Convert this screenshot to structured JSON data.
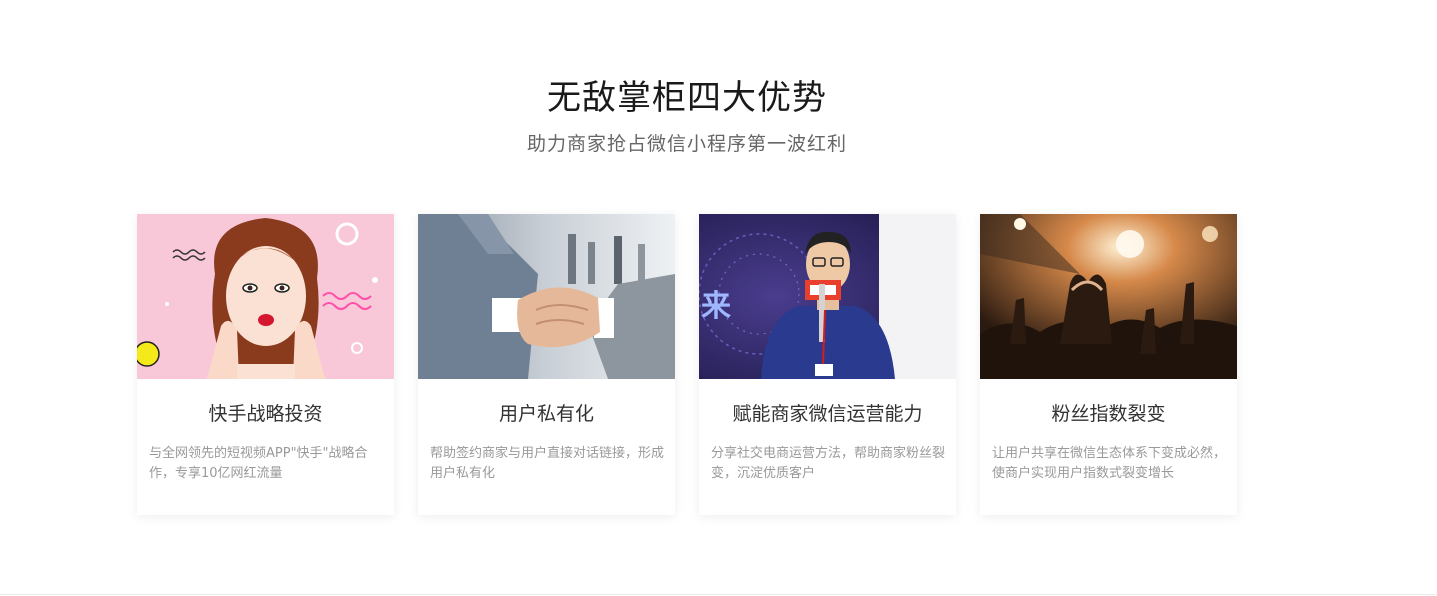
{
  "section": {
    "title": "无敌掌柜四大优势",
    "subtitle": "助力商家抢占微信小程序第一波红利"
  },
  "cards": [
    {
      "title": "快手战略投资",
      "description": "与全网领先的短视频APP\"快手\"战略合作，专享10亿网红流量",
      "image": "woman-surprised-photo"
    },
    {
      "title": "用户私有化",
      "description": "帮助签约商家与用户直接对话链接，形成用户私有化",
      "image": "handshake-photo"
    },
    {
      "title": "赋能商家微信运营能力",
      "description": "分享社交电商运营方法，帮助商家粉丝裂变，沉淀优质客户",
      "image": "speaker-on-stage-photo"
    },
    {
      "title": "粉丝指数裂变",
      "description": "让用户共享在微信生态体系下变成必然，使商户实现用户指数式裂变增长",
      "image": "concert-crowd-photo"
    }
  ]
}
